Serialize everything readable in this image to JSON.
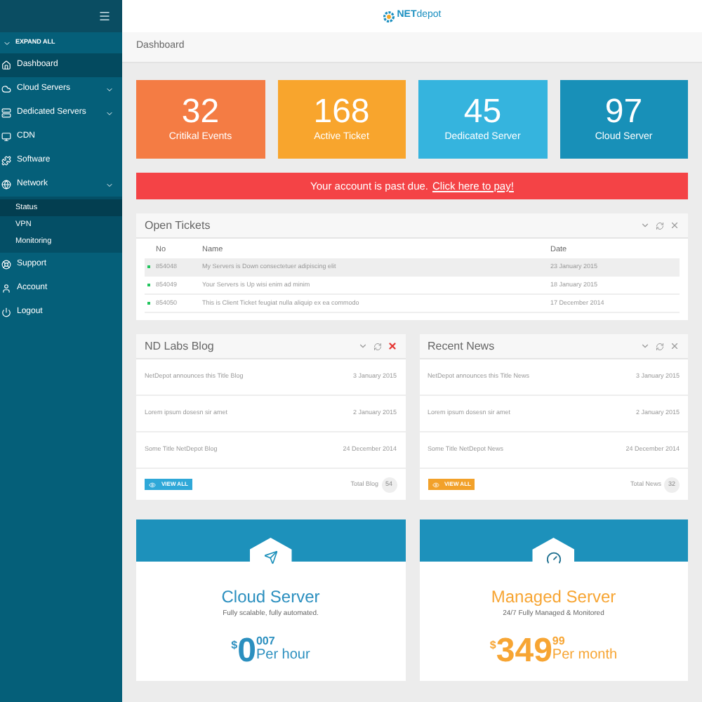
{
  "sidebar": {
    "expand_all": "EXPAND ALL",
    "items": [
      {
        "label": "Dashboard",
        "selected": true,
        "has_children": false
      },
      {
        "label": "Cloud Servers",
        "selected": false,
        "has_children": true
      },
      {
        "label": "Dedicated Servers",
        "selected": false,
        "has_children": true
      },
      {
        "label": "CDN",
        "selected": false,
        "has_children": false
      },
      {
        "label": "Software",
        "selected": false,
        "has_children": false
      },
      {
        "label": "Network",
        "selected": false,
        "has_children": true,
        "expanded": true,
        "children": [
          {
            "label": "Status",
            "selected": true
          },
          {
            "label": "VPN",
            "selected": false
          },
          {
            "label": "Monitoring",
            "selected": false
          }
        ]
      },
      {
        "label": "Support",
        "selected": false,
        "has_children": false
      },
      {
        "label": "Account",
        "selected": false,
        "has_children": false
      },
      {
        "label": "Logout",
        "selected": false,
        "has_children": false
      }
    ]
  },
  "header": {
    "logo_bold": "NET",
    "logo_light": "depot"
  },
  "breadcrumb": "Dashboard",
  "stats": [
    {
      "value": "32",
      "label": "Critikal Events",
      "color": "#f47c44"
    },
    {
      "value": "168",
      "label": "Active Ticket",
      "color": "#f8a52d"
    },
    {
      "value": "45",
      "label": "Dedicated Server",
      "color": "#35b4de"
    },
    {
      "value": "97",
      "label": "Cloud Server",
      "color": "#1890b8"
    }
  ],
  "alert": {
    "text": "Your account is past due.",
    "link": "Click here to pay!"
  },
  "open_tickets": {
    "title": "Open Tickets",
    "columns": [
      "No",
      "Name",
      "Date"
    ],
    "rows": [
      {
        "no": "854048",
        "name": "My Servers is Down consectetuer adipiscing elit",
        "date": "23 January 2015",
        "color": "#22c55e",
        "selected": true
      },
      {
        "no": "854049",
        "name": "Your Servers is Up wisi enim ad minim",
        "date": "18 January 2015",
        "color": "#22c55e",
        "selected": false
      },
      {
        "no": "854050",
        "name": "This is Client Ticket feugiat nulla aliquip ex ea commodo",
        "date": "17 December 2014",
        "color": "#22c55e",
        "selected": false
      }
    ]
  },
  "panels": [
    {
      "title": "ND Labs Blog",
      "close_hovered": true,
      "items": [
        {
          "title": "NetDepot announces this Title Blog",
          "date": "3 January 2015"
        },
        {
          "title": "Lorem ipsum dosesn sir amet",
          "date": "2 January 2015"
        },
        {
          "title": "Some Title NetDepot Blog",
          "date": "24 December 2014"
        }
      ],
      "button": "VIEW ALL",
      "color": "#2fa8d8",
      "total_label": "Total Blog",
      "total": "54"
    },
    {
      "title": "Recent News",
      "close_hovered": false,
      "items": [
        {
          "title": "NetDepot announces this Title News",
          "date": "3 January 2015"
        },
        {
          "title": "Lorem ipsum dosesn sir amet",
          "date": "2 January 2015"
        },
        {
          "title": "Some Title NetDepot News",
          "date": "24 December 2014"
        }
      ],
      "button": "VIEW ALL",
      "color": "#f2a12a",
      "total_label": "Total News",
      "total": "32"
    }
  ],
  "pricing": [
    {
      "title": "Cloud Server",
      "subtitle": "Fully scalable, fully automated.",
      "currency": "$",
      "amount": "0",
      "cents": "007",
      "period": "Per hour",
      "color": "#2b8fbf"
    },
    {
      "title": "Managed Server",
      "subtitle": "24/7 Fully Managed & Monitored",
      "currency": "$",
      "amount": "349",
      "cents": "99",
      "period": "Per month",
      "color": "#f7a533"
    }
  ]
}
